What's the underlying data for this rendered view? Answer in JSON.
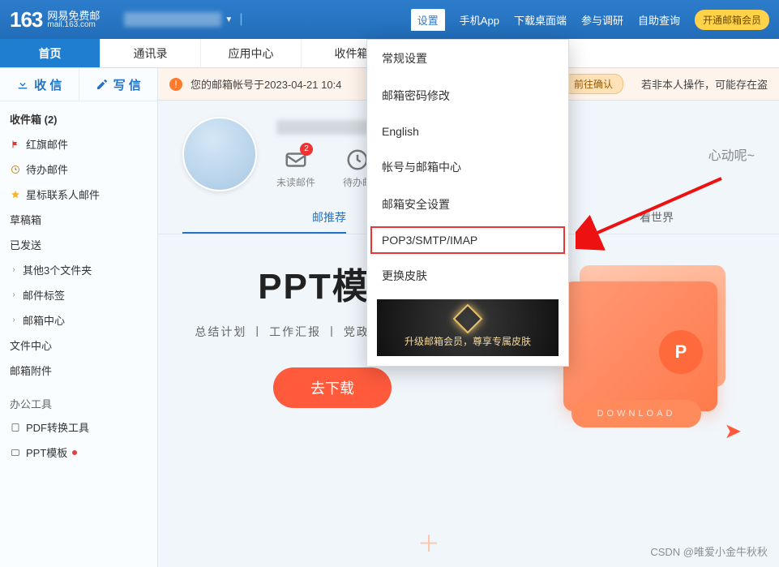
{
  "brand": {
    "logo": "163",
    "cn": "网易免费邮",
    "en": "mail.163.com"
  },
  "topnav": {
    "settings": "设置",
    "app": "手机App",
    "download": "下载桌面端",
    "survey": "参与调研",
    "selfhelp": "自助查询",
    "vip": "开通邮箱会员"
  },
  "tabs": {
    "home": "首页",
    "contacts": "通讯录",
    "appcenter": "应用中心",
    "inbox_tab": "收件箱"
  },
  "side_actions": {
    "receive": "收 信",
    "compose": "写 信"
  },
  "folders": {
    "inbox": "收件箱 (2)",
    "redflag": "红旗邮件",
    "todo": "待办邮件",
    "starred": "星标联系人邮件",
    "drafts": "草稿箱",
    "sent": "已发送",
    "others": "其他3个文件夹",
    "labels": "邮件标签",
    "center": "邮箱中心",
    "filecenter": "文件中心",
    "attachments": "邮箱附件"
  },
  "office": {
    "title": "办公工具",
    "pdf": "PDF转换工具",
    "ppt": "PPT模板"
  },
  "notice": {
    "text": "您的邮箱帐号于2023-04-21 10:4",
    "confirm": "前往确认",
    "warn": "若非本人操作，可能存在盗"
  },
  "hero": {
    "unread": "未读邮件",
    "unread_badge": "2",
    "todo": "待办邮",
    "slogan": "心动呢~"
  },
  "feed": {
    "rec": "邮推荐",
    "world": "看世界"
  },
  "promo": {
    "headline": "PPT模板",
    "sub": "总结计划 丨 工作汇报 丨 党政党建 丨 求职简历",
    "download": "去下载",
    "pill": "DOWNLOAD"
  },
  "settings_menu": {
    "general": "常规设置",
    "password": "邮箱密码修改",
    "english": "English",
    "account": "帐号与邮箱中心",
    "security": "邮箱安全设置",
    "pop3": "POP3/SMTP/IMAP",
    "skin": "更换皮肤",
    "skin_promo": "升级邮箱会员，尊享专属皮肤"
  },
  "watermark": "CSDN @唯爱小金牛秋秋"
}
